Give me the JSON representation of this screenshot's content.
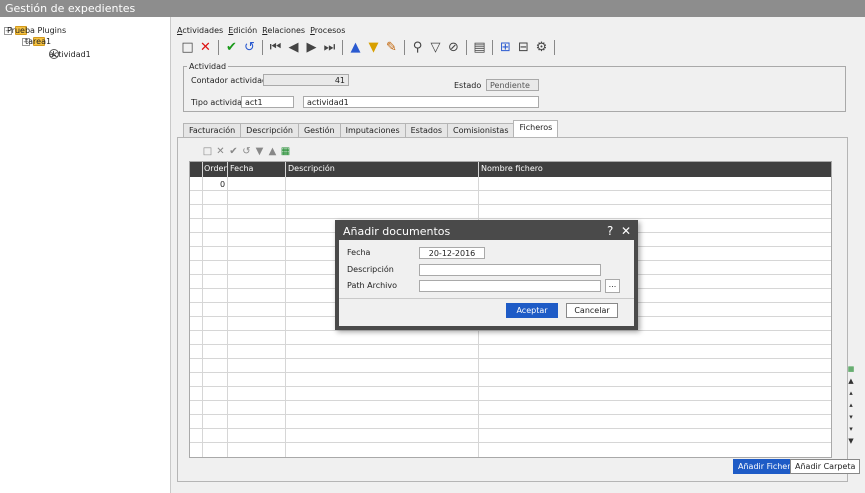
{
  "window": {
    "title": "Gestión de expedientes"
  },
  "tree": {
    "root": "Prueba Plugins",
    "child": "tarea1",
    "leaf": "actividad1"
  },
  "menu": [
    "Actividades",
    "Edición",
    "Relaciones",
    "Procesos"
  ],
  "actividad": {
    "legend": "Actividad",
    "contador_label": "Contador actividad",
    "contador_value": "41",
    "estado_label": "Estado",
    "estado_value": "Pendiente",
    "tipo_label": "Tipo actividad",
    "tipo_code": "act1",
    "tipo_name": "actividad1"
  },
  "tabs": [
    "Facturación",
    "Descripción",
    "Gestión",
    "Imputaciones",
    "Estados",
    "Comisionistas",
    "Ficheros"
  ],
  "grid": {
    "headers": [
      "Orden",
      "Fecha",
      "Descripción",
      "Nombre fichero"
    ],
    "rows": [
      {
        "orden": "0",
        "fecha": "",
        "descripcion": "",
        "nombre": ""
      }
    ]
  },
  "buttons": {
    "add_file": "Añadir Fichero",
    "add_folder": "Añadir Carpeta"
  },
  "dialog": {
    "title": "Añadir documentos",
    "help": "?",
    "close": "✕",
    "fecha_label": "Fecha",
    "fecha_value": "20-12-2016",
    "descripcion_label": "Descripción",
    "descripcion_value": "",
    "path_label": "Path Archivo",
    "path_value": "",
    "browse": "...",
    "ok": "Aceptar",
    "cancel": "Cancelar"
  },
  "colors": {
    "accent": "#1e5bc6",
    "title_bar": "#8d8d8d",
    "grid_header": "#3f3f3f",
    "dialog_frame": "#4a4a4a"
  },
  "icons": [
    "new-icon",
    "delete-icon",
    "confirm-icon",
    "undo-icon",
    "first-icon",
    "previous-icon",
    "next-icon",
    "last-icon",
    "move-up-icon",
    "move-down-icon",
    "clear-filter-icon",
    "search-icon",
    "filter-icon",
    "remove-filter-icon",
    "table-icon",
    "tree-icon",
    "hierarchy-icon",
    "settings-icon",
    "excel-icon"
  ]
}
